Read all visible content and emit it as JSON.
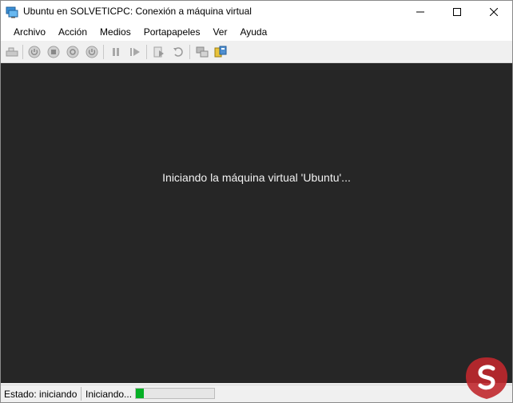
{
  "window": {
    "title": "Ubuntu en SOLVETICPC: Conexión a máquina virtual",
    "icon": "vm-connection-icon"
  },
  "menu": {
    "items": [
      "Archivo",
      "Acción",
      "Medios",
      "Portapapeles",
      "Ver",
      "Ayuda"
    ]
  },
  "toolbar": {
    "icons": [
      "ctrl-alt-del-icon",
      "power-start-icon",
      "power-off-icon",
      "shutdown-icon",
      "power-save-icon",
      "pause-icon",
      "resume-icon",
      "checkpoint-icon",
      "revert-icon",
      "enhanced-session-icon",
      "basic-session-icon"
    ]
  },
  "vm": {
    "message": "Iniciando la máquina virtual 'Ubuntu'..."
  },
  "statusbar": {
    "state": "Estado: iniciando",
    "progress_text": "Iniciando...",
    "progress_fraction": 0.1
  },
  "colors": {
    "vm_background": "#262626",
    "progress_green": "#06b025",
    "watermark_red": "#c0282d"
  }
}
